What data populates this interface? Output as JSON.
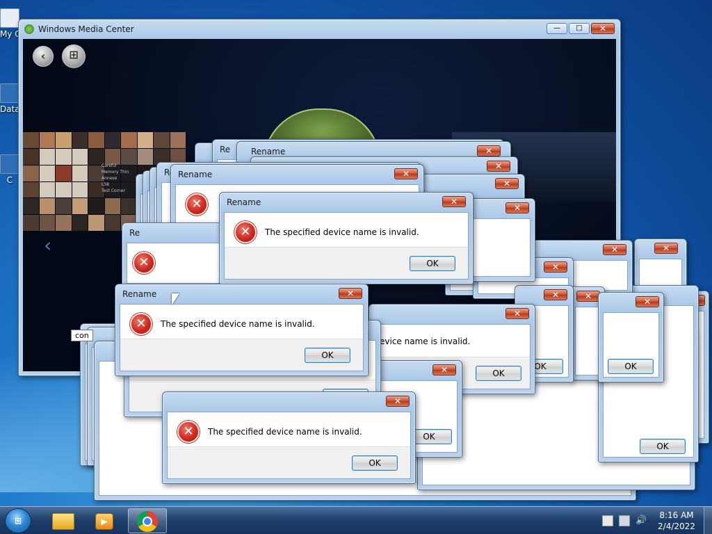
{
  "desktop": {
    "icons": [
      {
        "label": "My C"
      },
      {
        "label": "Data"
      },
      {
        "label": "C"
      }
    ],
    "tooltip": "con"
  },
  "media_center": {
    "title": "Windows Media Center",
    "buttons": {
      "minimize": "—",
      "maximize": "□",
      "close": "✕"
    },
    "thumb_caption_lines": [
      "Careful",
      "Memory Thin",
      "Annexe",
      "L58",
      "Test Corner"
    ]
  },
  "dialog": {
    "title": "Rename",
    "message": "The specified device name is invalid.",
    "partial_message": "evice name is invalid.",
    "partial_title": "Re",
    "ok_label": "OK",
    "close_label": "✕"
  },
  "taskbar": {
    "start_label": "⊞",
    "clock_time": "8:16 AM",
    "clock_date": "2/4/2022",
    "items": [
      {
        "name": "explorer",
        "icon": "folder-icon"
      },
      {
        "name": "media-player",
        "icon": "media-player-icon"
      },
      {
        "name": "chrome",
        "icon": "chrome-icon",
        "active": true
      }
    ],
    "tray_icons": [
      "flag-icon",
      "network-icon",
      "volume-icon"
    ]
  },
  "colors": {
    "titlebar": "#b9d1ec",
    "close_red": "#c9502f",
    "error_red": "#cf2a1f",
    "desktop_blue": "#1d74c6"
  }
}
